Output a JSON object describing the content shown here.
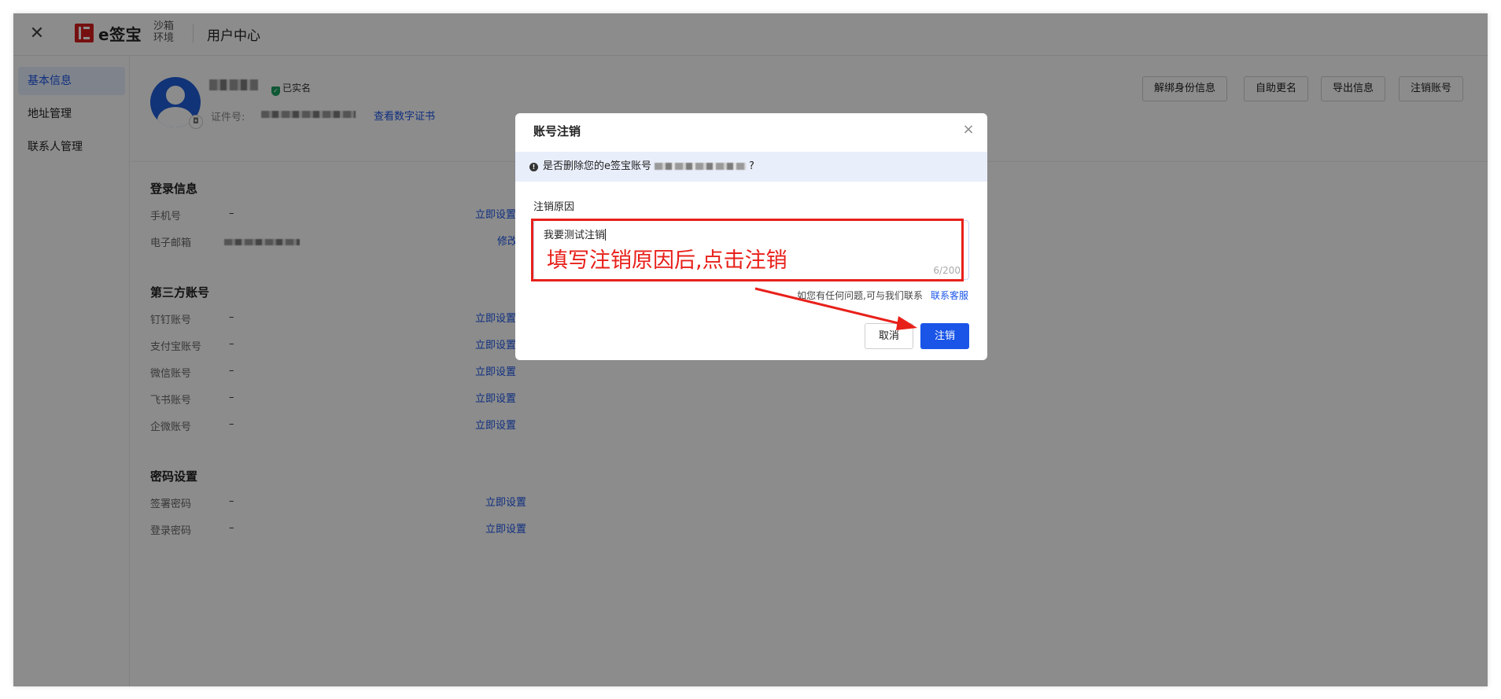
{
  "header": {
    "close_icon": "close-icon",
    "brand": "e签宝",
    "environment": "沙箱环境",
    "title": "用户中心"
  },
  "sidebar": {
    "items": [
      {
        "label": "基本信息",
        "active": true
      },
      {
        "label": "地址管理",
        "active": false
      },
      {
        "label": "联系人管理",
        "active": false
      }
    ]
  },
  "profile": {
    "verified_label": "已实名",
    "cert_label": "证件号:",
    "cert_link": "查看数字证书"
  },
  "actions": [
    "解绑身份信息",
    "自助更名",
    "导出信息",
    "注销账号"
  ],
  "login": {
    "title": "登录信息",
    "rows": [
      {
        "label": "手机号",
        "value": "–",
        "action": "立即设置"
      },
      {
        "label": "电子邮箱",
        "value": "",
        "action": "修改"
      }
    ]
  },
  "third_party": {
    "title": "第三方账号",
    "rows": [
      {
        "label": "钉钉账号",
        "value": "–",
        "action": "立即设置"
      },
      {
        "label": "支付宝账号",
        "value": "–",
        "action": "立即设置"
      },
      {
        "label": "微信账号",
        "value": "–",
        "action": "立即设置"
      },
      {
        "label": "飞书账号",
        "value": "–",
        "action": "立即设置"
      },
      {
        "label": "企微账号",
        "value": "–",
        "action": "立即设置"
      }
    ]
  },
  "password": {
    "title": "密码设置",
    "rows": [
      {
        "label": "签署密码",
        "value": "–",
        "action": "立即设置"
      },
      {
        "label": "登录密码",
        "value": "–",
        "action": "立即设置"
      }
    ]
  },
  "modal": {
    "title": "账号注销",
    "close": "×",
    "notice_prefix": "是否删除您的e签宝账号",
    "notice_suffix": "?",
    "reason_label": "注销原因",
    "reason_value": "我要测试注销",
    "counter": "6/200",
    "help_text": "如您有任何问题,可与我们联系",
    "help_link": "联系客服",
    "cancel": "取消",
    "confirm": "注销"
  },
  "annotation": {
    "text": "填写注销原因后,点击注销",
    "color": "#e8201a"
  },
  "colors": {
    "primary": "#1a55e8",
    "verified": "#1aa061",
    "brand_red": "#d81e1e"
  }
}
